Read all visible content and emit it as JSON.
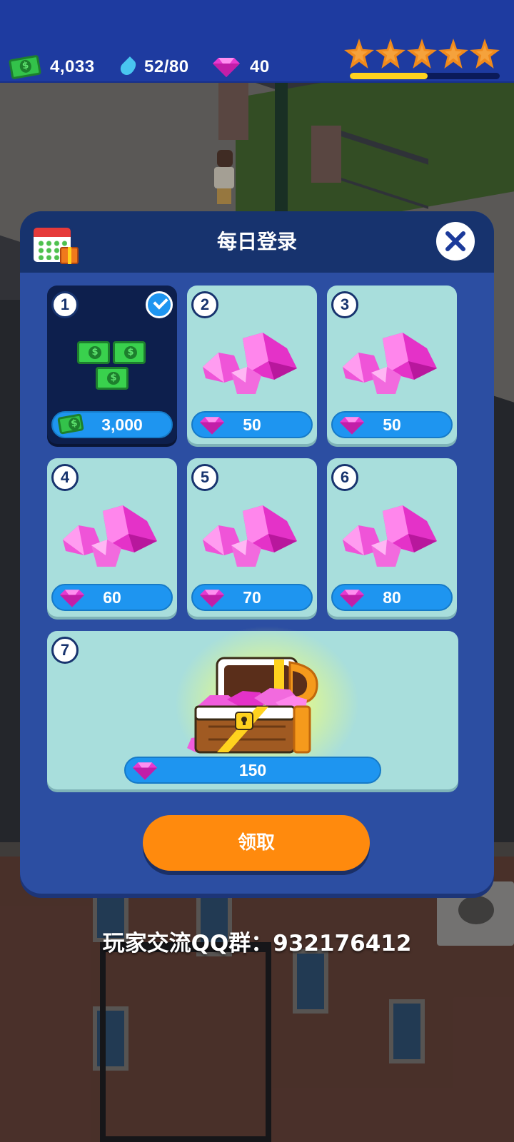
{
  "hud": {
    "cash": "4,033",
    "energy": "52/80",
    "gems": "40",
    "stars_count": 5,
    "level_progress": 0.52,
    "accent": "#1e3ba0"
  },
  "dialog": {
    "title": "每日登录",
    "close_icon": "close-icon",
    "days": [
      {
        "num": "1",
        "reward_type": "cash",
        "amount": "3,000",
        "claimed": true
      },
      {
        "num": "2",
        "reward_type": "gems",
        "amount": "50",
        "claimed": false
      },
      {
        "num": "3",
        "reward_type": "gems",
        "amount": "50",
        "claimed": false
      },
      {
        "num": "4",
        "reward_type": "gems",
        "amount": "60",
        "claimed": false
      },
      {
        "num": "5",
        "reward_type": "gems",
        "amount": "70",
        "claimed": false
      },
      {
        "num": "6",
        "reward_type": "gems",
        "amount": "80",
        "claimed": false
      },
      {
        "num": "7",
        "reward_type": "treasure-chest",
        "amount": "150",
        "claimed": false
      }
    ],
    "claim_button": "领取",
    "button_color": "#ff8a0d"
  },
  "footer": {
    "qq_group": "玩家交流QQ群：932176412"
  }
}
